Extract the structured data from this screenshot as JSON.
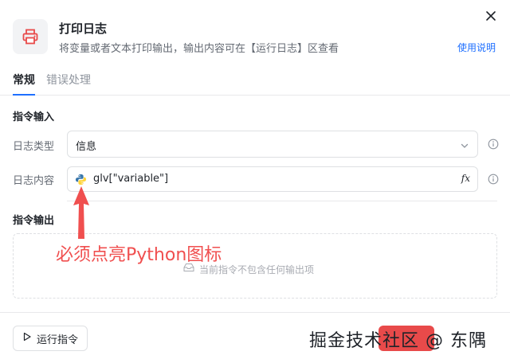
{
  "header": {
    "title": "打印日志",
    "description": "将变量或者文本打印输出，输出内容可在【运行日志】区查看",
    "help_link": "使用说明"
  },
  "tabs": [
    {
      "label": "常规",
      "active": true
    },
    {
      "label": "错误处理",
      "active": false
    }
  ],
  "input_section": {
    "title": "指令输入",
    "log_type": {
      "label": "日志类型",
      "value": "信息"
    },
    "log_content": {
      "label": "日志内容",
      "value": "glv[\"variable\"]",
      "fx_label": "fx"
    }
  },
  "output_section": {
    "title": "指令输出",
    "empty_text": "当前指令不包含任何输出项"
  },
  "annotation": {
    "text": "必须点亮Python图标",
    "color": "#f04f4f"
  },
  "footer": {
    "run_label": "运行指令",
    "watermark": "掘金技术社区 @ 东隅"
  },
  "colors": {
    "accent": "#1e6fff",
    "annotation": "#f04f4f",
    "ok_button": "#e84a4a"
  }
}
